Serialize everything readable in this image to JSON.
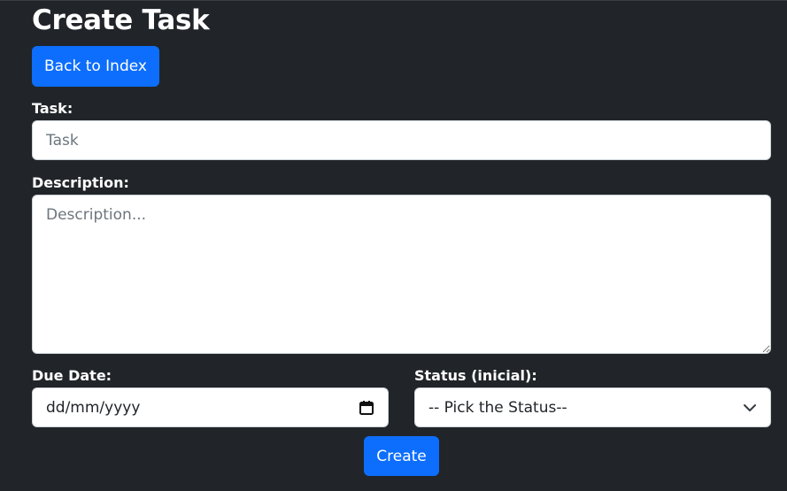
{
  "page": {
    "title": "Create Task",
    "back_button": "Back to Index"
  },
  "form": {
    "task_label": "Task:",
    "task_placeholder": "Task",
    "description_label": "Description:",
    "description_placeholder": "Description...",
    "due_date_label": "Due Date:",
    "due_date_value": "dd/mm/yyyy",
    "status_label": "Status (inicial):",
    "status_selected": "-- Pick the Status--",
    "create_button": "Create"
  },
  "colors": {
    "background": "#212529",
    "primary": "#0d6efd",
    "text": "#ffffff"
  }
}
